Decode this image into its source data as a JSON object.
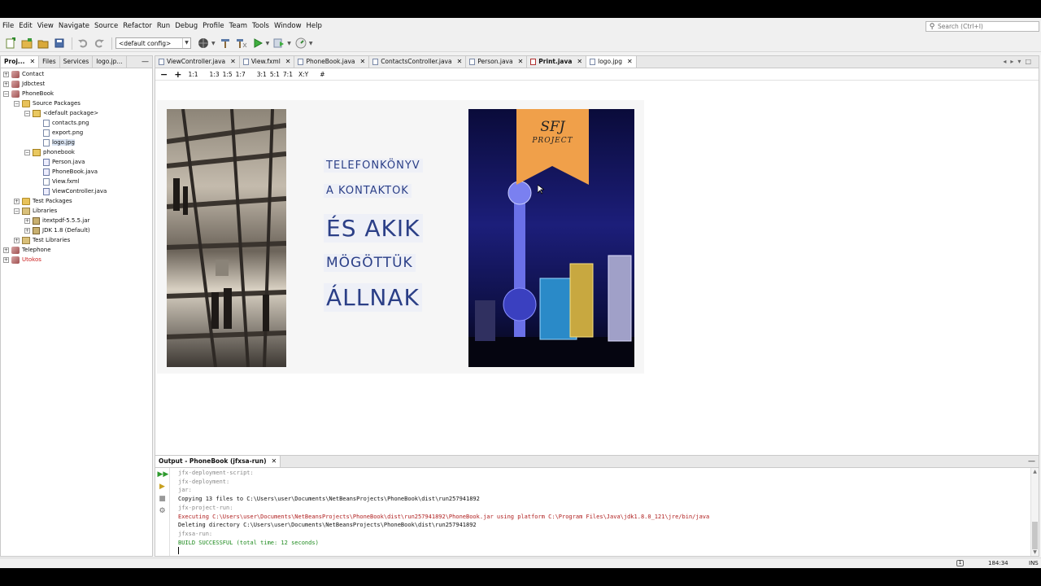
{
  "menu": [
    "File",
    "Edit",
    "View",
    "Navigate",
    "Source",
    "Refactor",
    "Run",
    "Debug",
    "Profile",
    "Team",
    "Tools",
    "Window",
    "Help"
  ],
  "search": {
    "placeholder": "Search (Ctrl+I)"
  },
  "toolbar": {
    "config": "<default config>"
  },
  "left_panel": {
    "tabs": [
      "Proj...",
      "Files",
      "Services",
      "logo.jp..."
    ],
    "tree": [
      {
        "label": "Contact",
        "depth": 0,
        "toggle": "+",
        "icon": "project"
      },
      {
        "label": "Jdbctest",
        "depth": 0,
        "toggle": "+",
        "icon": "project"
      },
      {
        "label": "PhoneBook",
        "depth": 0,
        "toggle": "-",
        "icon": "project"
      },
      {
        "label": "Source Packages",
        "depth": 1,
        "toggle": "-",
        "icon": "folder"
      },
      {
        "label": "<default package>",
        "depth": 2,
        "toggle": "-",
        "icon": "pkg"
      },
      {
        "label": "contacts.png",
        "depth": 3,
        "toggle": "",
        "icon": "file"
      },
      {
        "label": "export.png",
        "depth": 3,
        "toggle": "",
        "icon": "file"
      },
      {
        "label": "logo.jpg",
        "depth": 3,
        "toggle": "",
        "icon": "file",
        "selected": true
      },
      {
        "label": "phonebook",
        "depth": 2,
        "toggle": "-",
        "icon": "pkg"
      },
      {
        "label": "Person.java",
        "depth": 3,
        "toggle": "",
        "icon": "java"
      },
      {
        "label": "PhoneBook.java",
        "depth": 3,
        "toggle": "",
        "icon": "java"
      },
      {
        "label": "View.fxml",
        "depth": 3,
        "toggle": "",
        "icon": "file"
      },
      {
        "label": "ViewController.java",
        "depth": 3,
        "toggle": "",
        "icon": "java"
      },
      {
        "label": "Test Packages",
        "depth": 1,
        "toggle": "+",
        "icon": "folder"
      },
      {
        "label": "Libraries",
        "depth": 1,
        "toggle": "-",
        "icon": "lib"
      },
      {
        "label": "itextpdf-5.5.5.jar",
        "depth": 2,
        "toggle": "+",
        "icon": "jar"
      },
      {
        "label": "JDK 1.8 (Default)",
        "depth": 2,
        "toggle": "+",
        "icon": "jar"
      },
      {
        "label": "Test Libraries",
        "depth": 1,
        "toggle": "+",
        "icon": "lib"
      },
      {
        "label": "Telephone",
        "depth": 0,
        "toggle": "+",
        "icon": "project"
      },
      {
        "label": "Utokos",
        "depth": 0,
        "toggle": "+",
        "icon": "project",
        "red": true
      }
    ]
  },
  "editor": {
    "tabs": [
      {
        "label": "ViewController.java"
      },
      {
        "label": "View.fxml"
      },
      {
        "label": "PhoneBook.java"
      },
      {
        "label": "ContactsController.java"
      },
      {
        "label": "Person.java"
      },
      {
        "label": "Print.java",
        "bold": true
      },
      {
        "label": "logo.jpg",
        "active": true
      }
    ],
    "image_toolbar": [
      "−",
      "+",
      "1:1",
      "1:3",
      "1:5",
      "1:7",
      "3:1",
      "5:1",
      "7:1",
      "X:Y",
      "#"
    ]
  },
  "poster": {
    "lines": [
      "TELEFONKÖNYV",
      "A KONTAKTOK",
      "ÉS AKIK",
      "MÖGÖTTÜK",
      "ÁLLNAK"
    ],
    "banner_title": "SFJ",
    "banner_subtitle": "PROJECT"
  },
  "output": {
    "tab": "Output - PhoneBook (jfxsa-run)",
    "lines": [
      {
        "text": "jfx-deployment-script:",
        "style": "muted"
      },
      {
        "text": "jfx-deployment:",
        "style": "muted"
      },
      {
        "text": "jar:",
        "style": "muted"
      },
      {
        "text": "Copying 13 files to C:\\Users\\user\\Documents\\NetBeansProjects\\PhoneBook\\dist\\run257941892",
        "style": "normal"
      },
      {
        "text": "jfx-project-run:",
        "style": "muted"
      },
      {
        "text": "Executing C:\\Users\\user\\Documents\\NetBeansProjects\\PhoneBook\\dist\\run257941892\\PhoneBook.jar using platform C:\\Program Files\\Java\\jdk1.8.0_121\\jre/bin/java",
        "style": "err"
      },
      {
        "text": "Deleting directory C:\\Users\\user\\Documents\\NetBeansProjects\\PhoneBook\\dist\\run257941892",
        "style": "normal"
      },
      {
        "text": "jfxsa-run:",
        "style": "muted"
      },
      {
        "text": "BUILD SUCCESSFUL (total time: 12 seconds)",
        "style": "ok"
      }
    ]
  },
  "status": {
    "position": "184:34",
    "mode": "INS",
    "badge": "1"
  }
}
